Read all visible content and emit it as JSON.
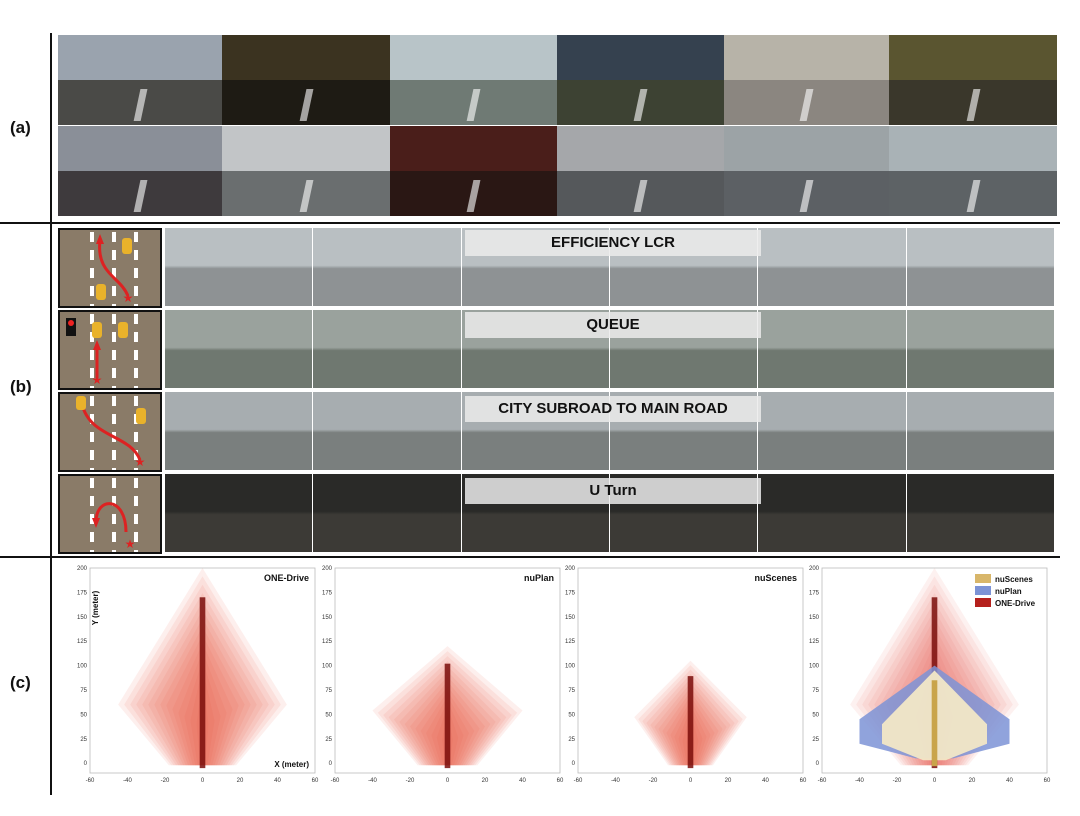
{
  "panels": {
    "a": "(a)",
    "b": "(b)",
    "c": "(c)"
  },
  "panel_a": {
    "description_icon": "driving-scene-photos",
    "scene_colors": [
      [
        "#9aa3ae",
        "#4a4a47"
      ],
      [
        "#3b3320",
        "#1e1b14"
      ],
      [
        "#b8c4c8",
        "#6f7a74"
      ],
      [
        "#35414f",
        "#3d4233"
      ],
      [
        "#b7b3a8",
        "#8b8680"
      ],
      [
        "#5a5530",
        "#3a372b"
      ],
      [
        "#8a8f98",
        "#3e3a3d"
      ],
      [
        "#c2c5c7",
        "#6a6e6f"
      ],
      [
        "#4a1e1a",
        "#2a1714"
      ],
      [
        "#a5a7aa",
        "#55585b"
      ],
      [
        "#9ca3a6",
        "#5c6064"
      ],
      [
        "#a9b2b6",
        "#5d6265"
      ]
    ]
  },
  "panel_b": {
    "rows": [
      {
        "label": "EFFICIENCY LCR",
        "colors": [
          "#b9bfc2",
          "#8e9294"
        ]
      },
      {
        "label": "QUEUE",
        "colors": [
          "#9aa29d",
          "#6f7870"
        ]
      },
      {
        "label": "CITY SUBROAD TO MAIN ROAD",
        "colors": [
          "#a7adb0",
          "#7a7f7e"
        ]
      },
      {
        "label": "U Turn",
        "colors": [
          "#2a2a28",
          "#3c3a36"
        ]
      }
    ],
    "scenario_icons": [
      "lane-change-icon",
      "queue-traffic-light-icon",
      "subroad-merge-icon",
      "u-turn-icon"
    ]
  },
  "chart_data": [
    {
      "type": "heatmap",
      "title": "ONE-Drive",
      "xlabel": "X (meter)",
      "ylabel": "Y (meter)",
      "xlim": [
        -60,
        60
      ],
      "ylim": [
        -10,
        200
      ],
      "xticks": [
        -60,
        -40,
        -20,
        0,
        20,
        40,
        60
      ],
      "yticks": [
        0,
        25,
        50,
        75,
        100,
        125,
        150,
        175,
        200
      ],
      "ymax_extent": 200,
      "half_width_at_base": 45
    },
    {
      "type": "heatmap",
      "title": "nuPlan",
      "xlabel": "",
      "ylabel": "",
      "xlim": [
        -60,
        60
      ],
      "ylim": [
        -10,
        200
      ],
      "xticks": [
        -60,
        -40,
        -20,
        0,
        20,
        40,
        60
      ],
      "yticks": [
        0,
        25,
        50,
        75,
        100,
        125,
        150,
        175,
        200
      ],
      "ymax_extent": 120,
      "half_width_at_base": 40
    },
    {
      "type": "heatmap",
      "title": "nuScenes",
      "xlabel": "",
      "ylabel": "",
      "xlim": [
        -60,
        60
      ],
      "ylim": [
        -10,
        200
      ],
      "xticks": [
        -60,
        -40,
        -20,
        0,
        20,
        40,
        60
      ],
      "yticks": [
        0,
        25,
        50,
        75,
        100,
        125,
        150,
        175,
        200
      ],
      "ymax_extent": 105,
      "half_width_at_base": 30
    },
    {
      "type": "heatmap",
      "title": "",
      "xlabel": "",
      "ylabel": "",
      "xlim": [
        -60,
        60
      ],
      "ylim": [
        -10,
        200
      ],
      "xticks": [
        -60,
        -40,
        -20,
        0,
        20,
        40,
        60
      ],
      "yticks": [
        0,
        25,
        50,
        75,
        100,
        125,
        150,
        175,
        200
      ],
      "legend": [
        {
          "name": "nuScenes",
          "color": "#d8b66a"
        },
        {
          "name": "nuPlan",
          "color": "#7c93d6"
        },
        {
          "name": "ONE-Drive",
          "color": "#b5201c"
        }
      ],
      "legend_position": "top-right"
    }
  ]
}
